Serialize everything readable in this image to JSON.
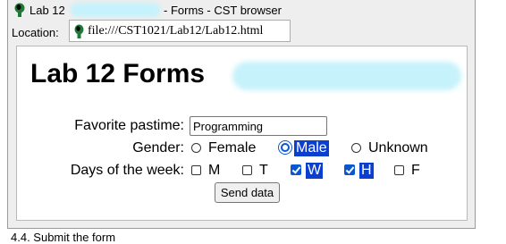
{
  "window": {
    "title_prefix": "Lab 12",
    "title_suffix": "- Forms - CST browser"
  },
  "location": {
    "label": "Location:",
    "url": "file:///CST1021/Lab12/Lab12.html"
  },
  "page": {
    "title": "Lab 12 Forms"
  },
  "form": {
    "pastime": {
      "label": "Favorite pastime:",
      "value": "Programming"
    },
    "gender": {
      "label": "Gender:",
      "options": [
        {
          "label": "Female",
          "checked": false
        },
        {
          "label": "Male",
          "checked": true
        },
        {
          "label": "Unknown",
          "checked": false
        }
      ]
    },
    "days": {
      "label": "Days of the week:",
      "options": [
        {
          "label": "M",
          "checked": false
        },
        {
          "label": "T",
          "checked": false
        },
        {
          "label": "W",
          "checked": true
        },
        {
          "label": "H",
          "checked": true
        },
        {
          "label": "F",
          "checked": false
        }
      ]
    },
    "submit_label": "Send data"
  },
  "caption": "4.4. Submit the form",
  "colors": {
    "accent": "#0b57d0",
    "selection": "#0b3fd0",
    "redaction": "#c6f2fb"
  },
  "icons": {
    "app": "browser-logo-icon",
    "location": "file-page-icon"
  }
}
